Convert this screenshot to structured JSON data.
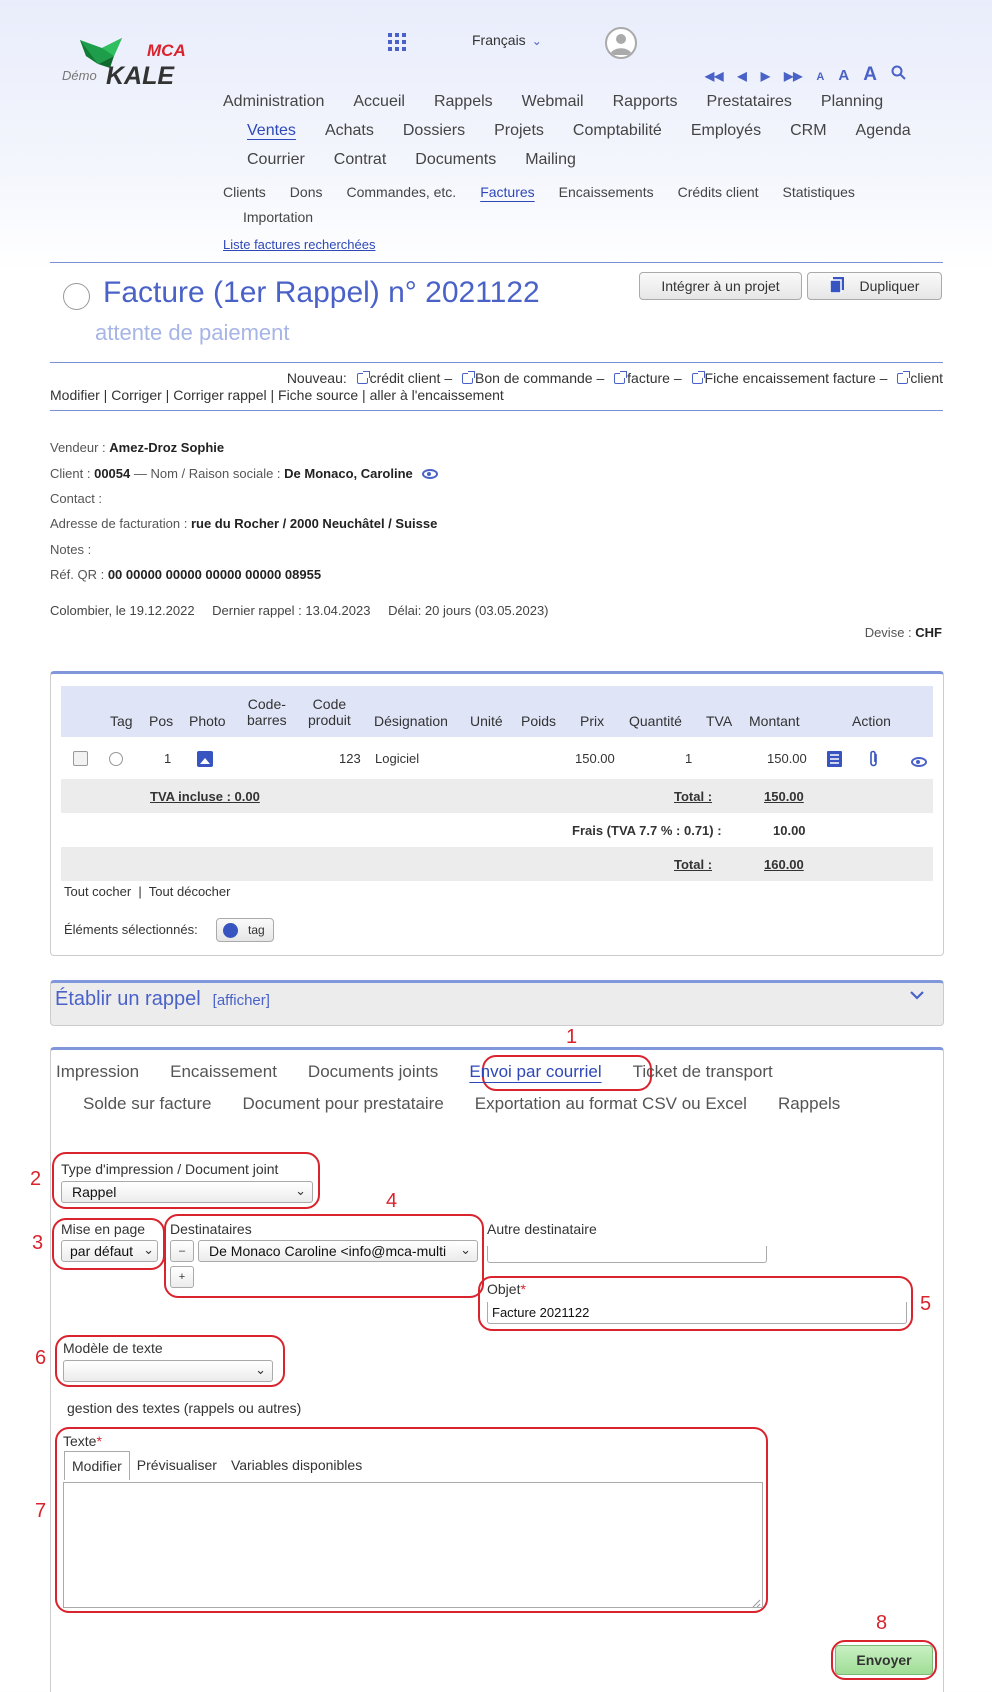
{
  "header": {
    "logo_text": "Démo MCA KALE",
    "language": "Français",
    "icons": [
      "apps-grid-icon",
      "user-avatar-icon",
      "first-page-icon",
      "previous-icon",
      "next-icon",
      "last-page-icon",
      "font-small-icon",
      "font-medium-icon",
      "font-large-icon",
      "search-icon"
    ],
    "font_sizes": [
      "A",
      "A",
      "A"
    ]
  },
  "nav": {
    "row1": [
      "Administration",
      "Accueil",
      "Rappels",
      "Webmail",
      "Rapports",
      "Prestataires",
      "Planning"
    ],
    "row2": [
      "Ventes",
      "Achats",
      "Dossiers",
      "Projets",
      "Comptabilité",
      "Employés",
      "CRM",
      "Agenda"
    ],
    "row3": [
      "Courrier",
      "Contrat",
      "Documents",
      "Mailing"
    ],
    "active": "Ventes"
  },
  "subnav": {
    "row1": [
      "Clients",
      "Dons",
      "Commandes, etc.",
      "Factures",
      "Encaissements",
      "Crédits client",
      "Statistiques"
    ],
    "row2": [
      "Importation"
    ],
    "active": "Factures",
    "liste_link": "Liste factures recherchées"
  },
  "invoice": {
    "title": "Facture (1er Rappel) n° 2021122",
    "status": "attente de paiement",
    "btn_integrer": "Intégrer à un projet",
    "btn_dupliquer": "Dupliquer",
    "nouveau_label": "Nouveau:",
    "nouveau_links": [
      "crédit client",
      "Bon de commande",
      "facture",
      "Fiche encaissement facture",
      "client"
    ],
    "actions": [
      "Modifier",
      "Corriger",
      "Corriger rappel",
      "Fiche source",
      "aller à l'encaissement"
    ]
  },
  "info": {
    "vendeur_label": "Vendeur :",
    "vendeur": "Amez-Droz Sophie",
    "client_label": "Client :",
    "client_num": "00054",
    "nom_label": "— Nom / Raison sociale :",
    "client_name": "De Monaco, Caroline",
    "contact_label": "Contact :",
    "adresse_label": "Adresse de facturation :",
    "adresse": "rue du Rocher / 2000 Neuchâtel / Suisse",
    "notes_label": "Notes :",
    "ref_label": "Réf. QR :",
    "ref_qr": "00 00000 00000 00000 00000 08955",
    "lieu_date": "Colombier, le 19.12.2022",
    "dernier_rappel": "Dernier rappel : 13.04.2023",
    "delai": "Délai: 20 jours (03.05.2023)",
    "devise_label": "Devise :",
    "devise": "CHF"
  },
  "table": {
    "headers": {
      "tag": "Tag",
      "pos": "Pos",
      "photo": "Photo",
      "code_barres_1": "Code-",
      "code_barres_2": "barres",
      "code_produit_1": "Code",
      "code_produit_2": "produit",
      "designation": "Désignation",
      "unite": "Unité",
      "poids": "Poids",
      "prix": "Prix",
      "quantite": "Quantité",
      "tva": "TVA",
      "montant": "Montant",
      "action": "Action"
    },
    "row": {
      "pos": "1",
      "code_produit": "123",
      "designation": "Logiciel",
      "prix": "150.00",
      "quantite": "1",
      "montant": "150.00"
    },
    "tva_incluse": "TVA incluse : 0.00",
    "total_label": "Total :",
    "total1": "150.00",
    "frais_label": "Frais (TVA 7.7 % : 0.71) :",
    "frais": "10.00",
    "total2": "160.00",
    "tout_cocher": "Tout cocher",
    "tout_decocher": "Tout décocher",
    "elements_label": "Éléments sélectionnés:",
    "tag_btn": "tag"
  },
  "rappel": {
    "title": "Établir un rappel",
    "afficher": "[afficher]"
  },
  "tabs": {
    "row1": [
      "Impression",
      "Encaissement",
      "Documents joints",
      "Envoi par courriel",
      "Ticket de transport"
    ],
    "row2": [
      "Solde sur facture",
      "Document pour prestataire",
      "Exportation au format CSV ou Excel",
      "Rappels"
    ],
    "active": "Envoi par courriel"
  },
  "form": {
    "type_label": "Type d'impression / Document joint",
    "type_value": "Rappel",
    "mise_label": "Mise en page",
    "mise_value": "par défaut",
    "dest_label": "Destinataires",
    "dest_value": "De Monaco Caroline <info@mca-multi",
    "dest_minus": "–",
    "dest_plus": "+",
    "autre_label": "Autre destinataire",
    "autre_value": "",
    "objet_label": "Objet",
    "objet_value": "Facture 2021122",
    "modele_label": "Modèle de texte",
    "modele_value": "",
    "gestion_text": "gestion des textes (rappels ou autres)",
    "texte_label": "Texte",
    "editor_tabs": [
      "Modifier",
      "Prévisualiser",
      "Variables disponibles"
    ],
    "texte_value": "",
    "envoyer": "Envoyer",
    "required_mark": "*"
  },
  "annotations": [
    "1",
    "2",
    "3",
    "4",
    "5",
    "6",
    "7",
    "8"
  ],
  "colors": {
    "accent": "#4a62c8",
    "annotation_red": "#d9232d",
    "send_green": "#a8e29f",
    "table_header": "#dfe4f7"
  }
}
